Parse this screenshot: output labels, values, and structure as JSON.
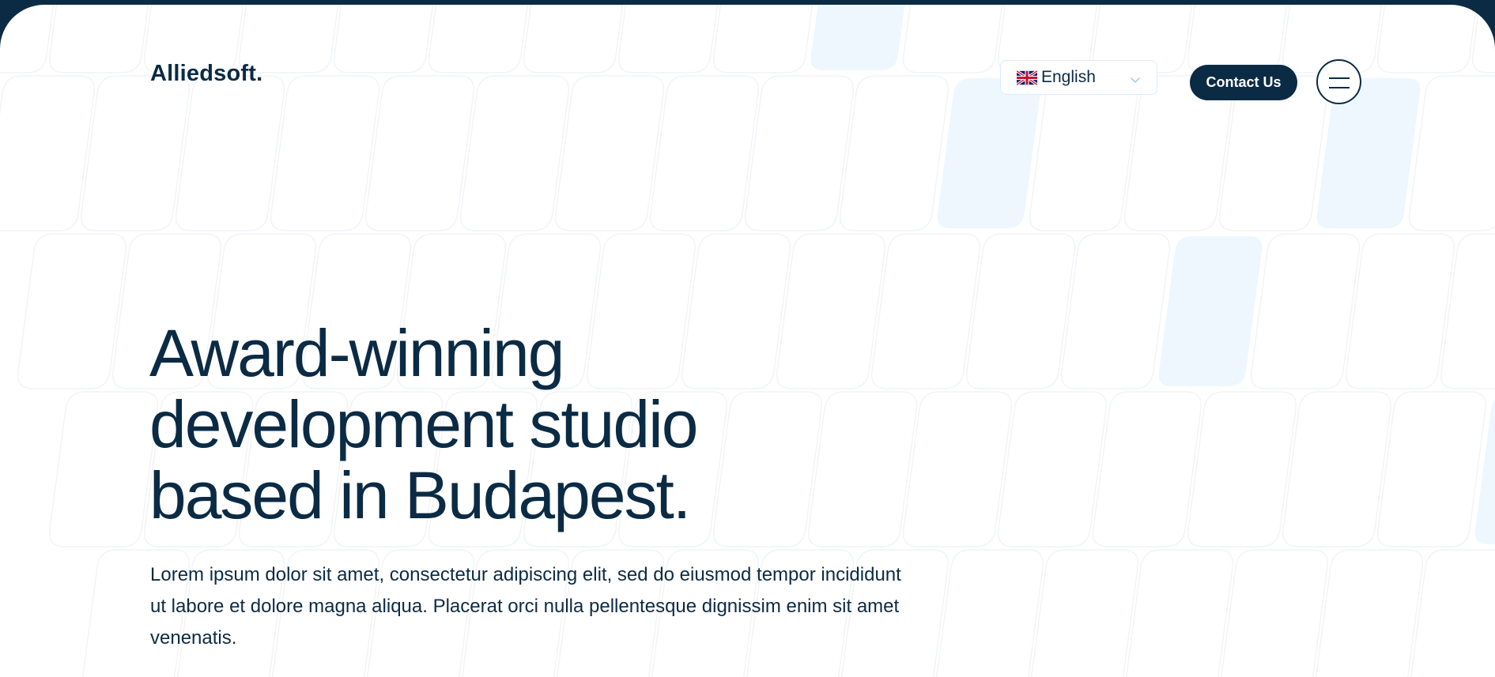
{
  "brand": {
    "logo_text": "Alliedsoft."
  },
  "header": {
    "language": {
      "selected": "English",
      "flag_icon": "uk-flag-icon"
    },
    "contact_label": "Contact Us",
    "menu_icon": "hamburger-menu-icon"
  },
  "hero": {
    "title_lines": [
      "Award-winning",
      "development studio",
      "based in Budapest."
    ],
    "description": "Lorem ipsum dolor sit amet, consectetur adipiscing elit, sed do eiusmod tempor incididunt ut labore et dolore magna aliqua. Placerat orci nulla pellentesque dignissim enim sit amet venenatis."
  },
  "colors": {
    "navy": "#0b2b45",
    "background": "#ffffff",
    "tile_fill": "#eef7fe",
    "tile_stroke": "#f1f4f7"
  }
}
